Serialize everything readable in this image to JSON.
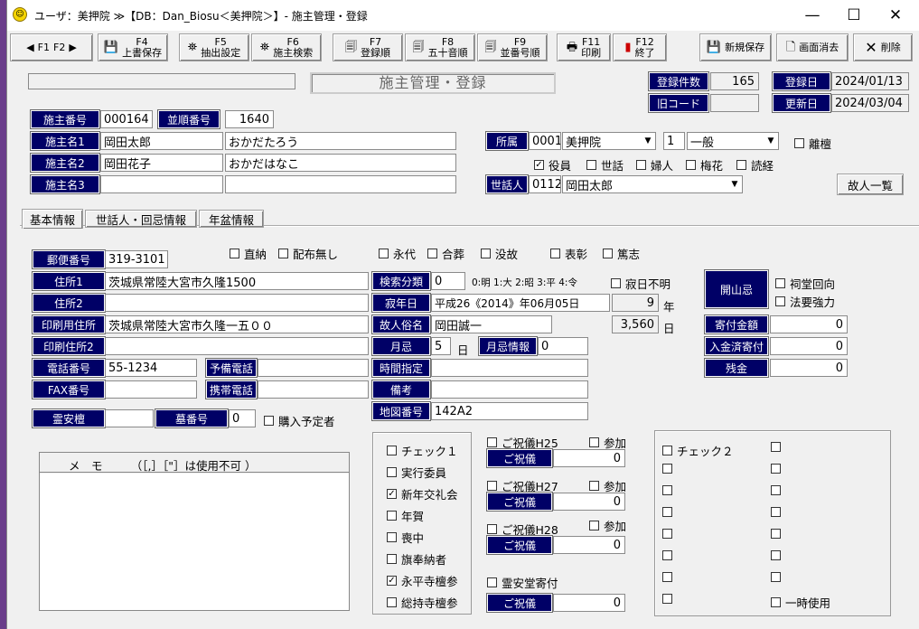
{
  "window": {
    "title": "ユーザ：美押院 ≫【DB：Dan_Biosu＜美押院＞】- 施主管理・登録",
    "min": "—",
    "max": "☐",
    "close": "✕"
  },
  "toolbar": {
    "f1": "F1",
    "f2": "F2",
    "f4": "F4",
    "f4l": "上書保存",
    "f5": "F5",
    "f5l": "抽出設定",
    "f6": "F6",
    "f6l": "施主検索",
    "f7": "F7",
    "f7l": "登録順",
    "f8": "F8",
    "f8l": "五十音順",
    "f9": "F9",
    "f9l": "並番号順",
    "f11": "F11",
    "f11l": "印刷",
    "f12": "F12",
    "f12l": "終了",
    "new": "新規保存",
    "clear": "画面消去",
    "del": "削除"
  },
  "header": {
    "title": "施主管理・登録",
    "count_label": "登録件数",
    "count": "165",
    "reg_label": "登録日",
    "reg": "2024/01/13",
    "old_label": "旧コード",
    "old": "",
    "upd_label": "更新日",
    "upd": "2024/03/04"
  },
  "owner": {
    "no_label": "施主番号",
    "no": "000164",
    "seq_label": "並順番号",
    "seq": "1640",
    "n1_label": "施主名1",
    "n1": "岡田太郎",
    "n1k": "おかだたろう",
    "n2_label": "施主名2",
    "n2": "岡田花子",
    "n2k": "おかだはなこ",
    "n3_label": "施主名3",
    "n3": "",
    "n3k": ""
  },
  "aff": {
    "label": "所属",
    "code": "0001",
    "name": "美押院",
    "kcode": "1",
    "kind": "一般",
    "dan": "離檀",
    "c1": "役員",
    "c2": "世話",
    "c3": "婦人",
    "c4": "梅花",
    "c5": "読経",
    "sewa_label": "世話人",
    "sewa_code": "0112",
    "sewa": "岡田太郎",
    "kojin_btn": "故人一覧"
  },
  "tabs": [
    "基本情報",
    "世話人・回忌情報",
    "年盆情報"
  ],
  "basic": {
    "zip_label": "郵便番号",
    "zip": "319-3101",
    "chk_direct": "直納",
    "chk_nodist": "配布無し",
    "chk_eidai": "永代",
    "chk_gosou": "合葬",
    "chk_botsu": "没故",
    "chk_hyosho": "表彰",
    "chk_tokushi": "篤志",
    "addr1_label": "住所1",
    "addr1": "茨城県常陸大宮市久隆1500",
    "addr2_label": "住所2",
    "addr2": "",
    "paddr_label": "印刷用住所",
    "paddr": "茨城県常陸大宮市久隆一五００",
    "paddr2_label": "印刷住所2",
    "paddr2": "",
    "tel_label": "電話番号",
    "tel": "55-1234",
    "tel2_label": "予備電話",
    "tel2": "",
    "fax_label": "FAX番号",
    "fax": "",
    "mobile_label": "携帯電話",
    "mobile": "",
    "reian_label": "霊安檀",
    "reian": "",
    "grave_label": "墓番号",
    "grave": "0",
    "purchase": "購入予定者",
    "memo_label": "メ　モ　　　（［,］［\"］は使用不可 ）",
    "memo": ""
  },
  "death": {
    "search_label": "検索分類",
    "search": "0",
    "search_hint": "0:明 1:大 2:昭 3:平 4:令",
    "unknown": "寂日不明",
    "date_label": "寂年日",
    "date": "平成26《2014》年06月05日",
    "years": "9",
    "years_unit": "年",
    "name_label": "故人俗名",
    "name": "岡田誠一",
    "days": "3,560",
    "days_unit": "日",
    "month_label": "月忌",
    "month": "5",
    "month_unit": "日",
    "minfo_label": "月忌情報",
    "minfo": "0",
    "time_label": "時間指定",
    "time": "",
    "note_label": "備考",
    "note": "",
    "map_label": "地図番号",
    "map": "142A2"
  },
  "kaisan": {
    "label": "開山忌",
    "c1": "祠堂回向",
    "c2": "法要強力",
    "donate_label": "寄付金額",
    "donate": "0",
    "paid_label": "入金済寄付",
    "paid": "0",
    "rest_label": "残金",
    "rest": "0"
  },
  "checks1": [
    {
      "l": "チェック１",
      "v": ""
    },
    {
      "l": "実行委員",
      "v": ""
    },
    {
      "l": "新年交礼会",
      "v": "✓"
    },
    {
      "l": "年賀",
      "v": ""
    },
    {
      "l": "喪中",
      "v": ""
    },
    {
      "l": "旗奉納者",
      "v": ""
    },
    {
      "l": "永平寺檀参",
      "v": "✓"
    },
    {
      "l": "総持寺檀参",
      "v": ""
    }
  ],
  "shugi": [
    {
      "t": "ご祝儀H25",
      "p": "参加",
      "l": "ご祝儀",
      "v": "0"
    },
    {
      "t": "ご祝儀H27",
      "p": "参加",
      "l": "ご祝儀",
      "v": "0"
    },
    {
      "t": "ご祝儀H28",
      "p": "参加",
      "l": "ご祝儀",
      "v": "0"
    },
    {
      "t": "霊安堂寄付",
      "p": "",
      "l": "ご祝儀",
      "v": "0"
    }
  ],
  "checks2": {
    "title": "チェック２",
    "last": "一時使用"
  }
}
